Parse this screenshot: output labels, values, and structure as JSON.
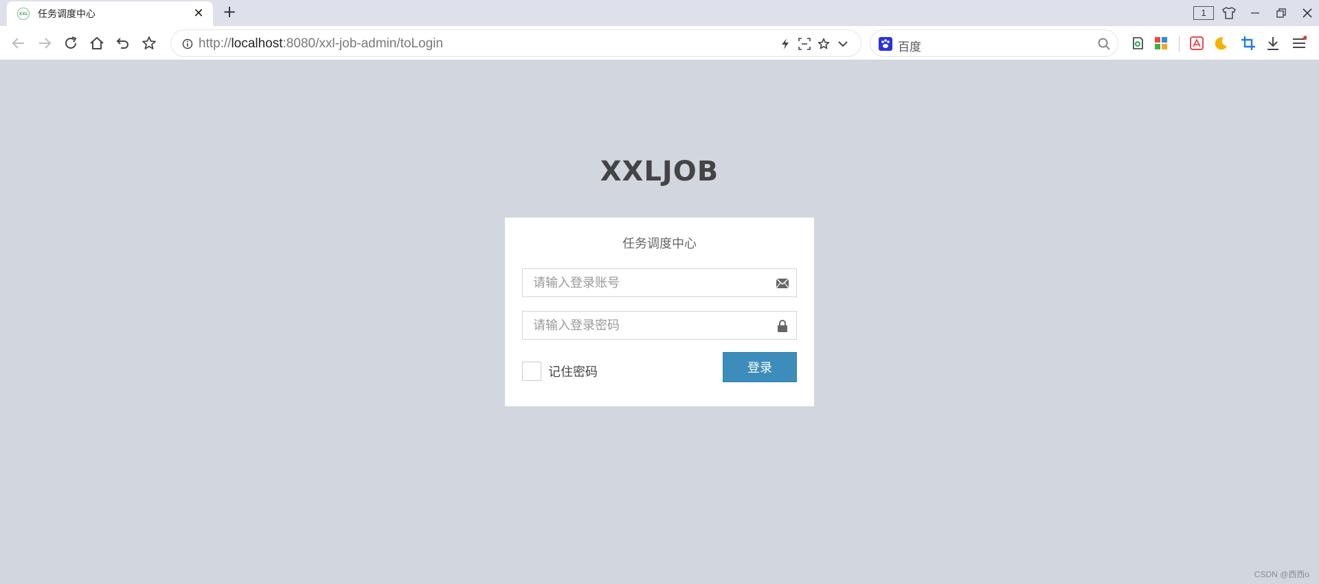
{
  "browser": {
    "tab_title": "任务调度中心",
    "favicon_text": "XXL",
    "new_tab_label": "+",
    "close_tab_label": "✕",
    "tab_count": "1",
    "url_scheme": "http://",
    "url_host": "localhost",
    "url_rest": ":8080/xxl-job-admin/toLogin",
    "search_engine": "百度",
    "icons": {
      "back": "arrow-left-icon",
      "forward": "arrow-right-icon",
      "reload": "reload-icon",
      "home": "home-icon",
      "undo": "undo-icon",
      "favorite": "star-icon"
    }
  },
  "login": {
    "logo": "XXLJOB",
    "message": "任务调度中心",
    "username_placeholder": "请输入登录账号",
    "password_placeholder": "请输入登录密码",
    "remember_label": "记住密码",
    "submit_label": "登录"
  },
  "colors": {
    "page_background": "#d2d6de",
    "primary_button": "#3c8dbc"
  },
  "watermark": "CSDN @西西o"
}
